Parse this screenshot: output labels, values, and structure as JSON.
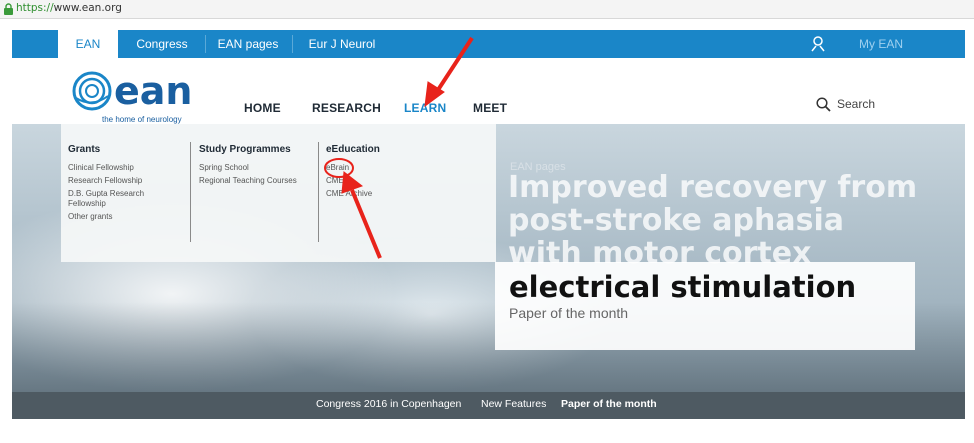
{
  "browser": {
    "url_scheme": "https://",
    "url_rest": "www.ean.org"
  },
  "topnav": {
    "tabs": [
      "EAN",
      "Congress",
      "EAN pages",
      "Eur J Neurol"
    ],
    "my_ean": "My EAN"
  },
  "header": {
    "logo_text": "ean",
    "tagline": "the home of neurology",
    "nav": [
      "HOME",
      "RESEARCH",
      "LEARN",
      "MEET"
    ],
    "active_nav": "LEARN",
    "search_label": "Search"
  },
  "dropdown": {
    "columns": [
      {
        "heading": "Grants",
        "items": [
          "Clinical Fellowship",
          "Research Fellowship",
          "D.B. Gupta Research Fellowship",
          "Other grants"
        ]
      },
      {
        "heading": "Study Programmes",
        "items": [
          "Spring School",
          "Regional Teaching Courses"
        ]
      },
      {
        "heading": "eEducation",
        "items": [
          "eBrain",
          "CME",
          "CME Archive"
        ]
      }
    ]
  },
  "hero": {
    "kicker": "EAN pages",
    "title_lines": [
      "Improved recovery from",
      "post-stroke aphasia",
      "with motor cortex"
    ],
    "card_title": "electrical stimulation",
    "card_subtitle": "Paper of the month"
  },
  "strip": {
    "links": [
      "Congress 2016 in Copenhagen",
      "New Features",
      "Paper of the month"
    ]
  },
  "colors": {
    "brand_blue": "#1a86c8",
    "annotation_red": "#e8231b"
  }
}
